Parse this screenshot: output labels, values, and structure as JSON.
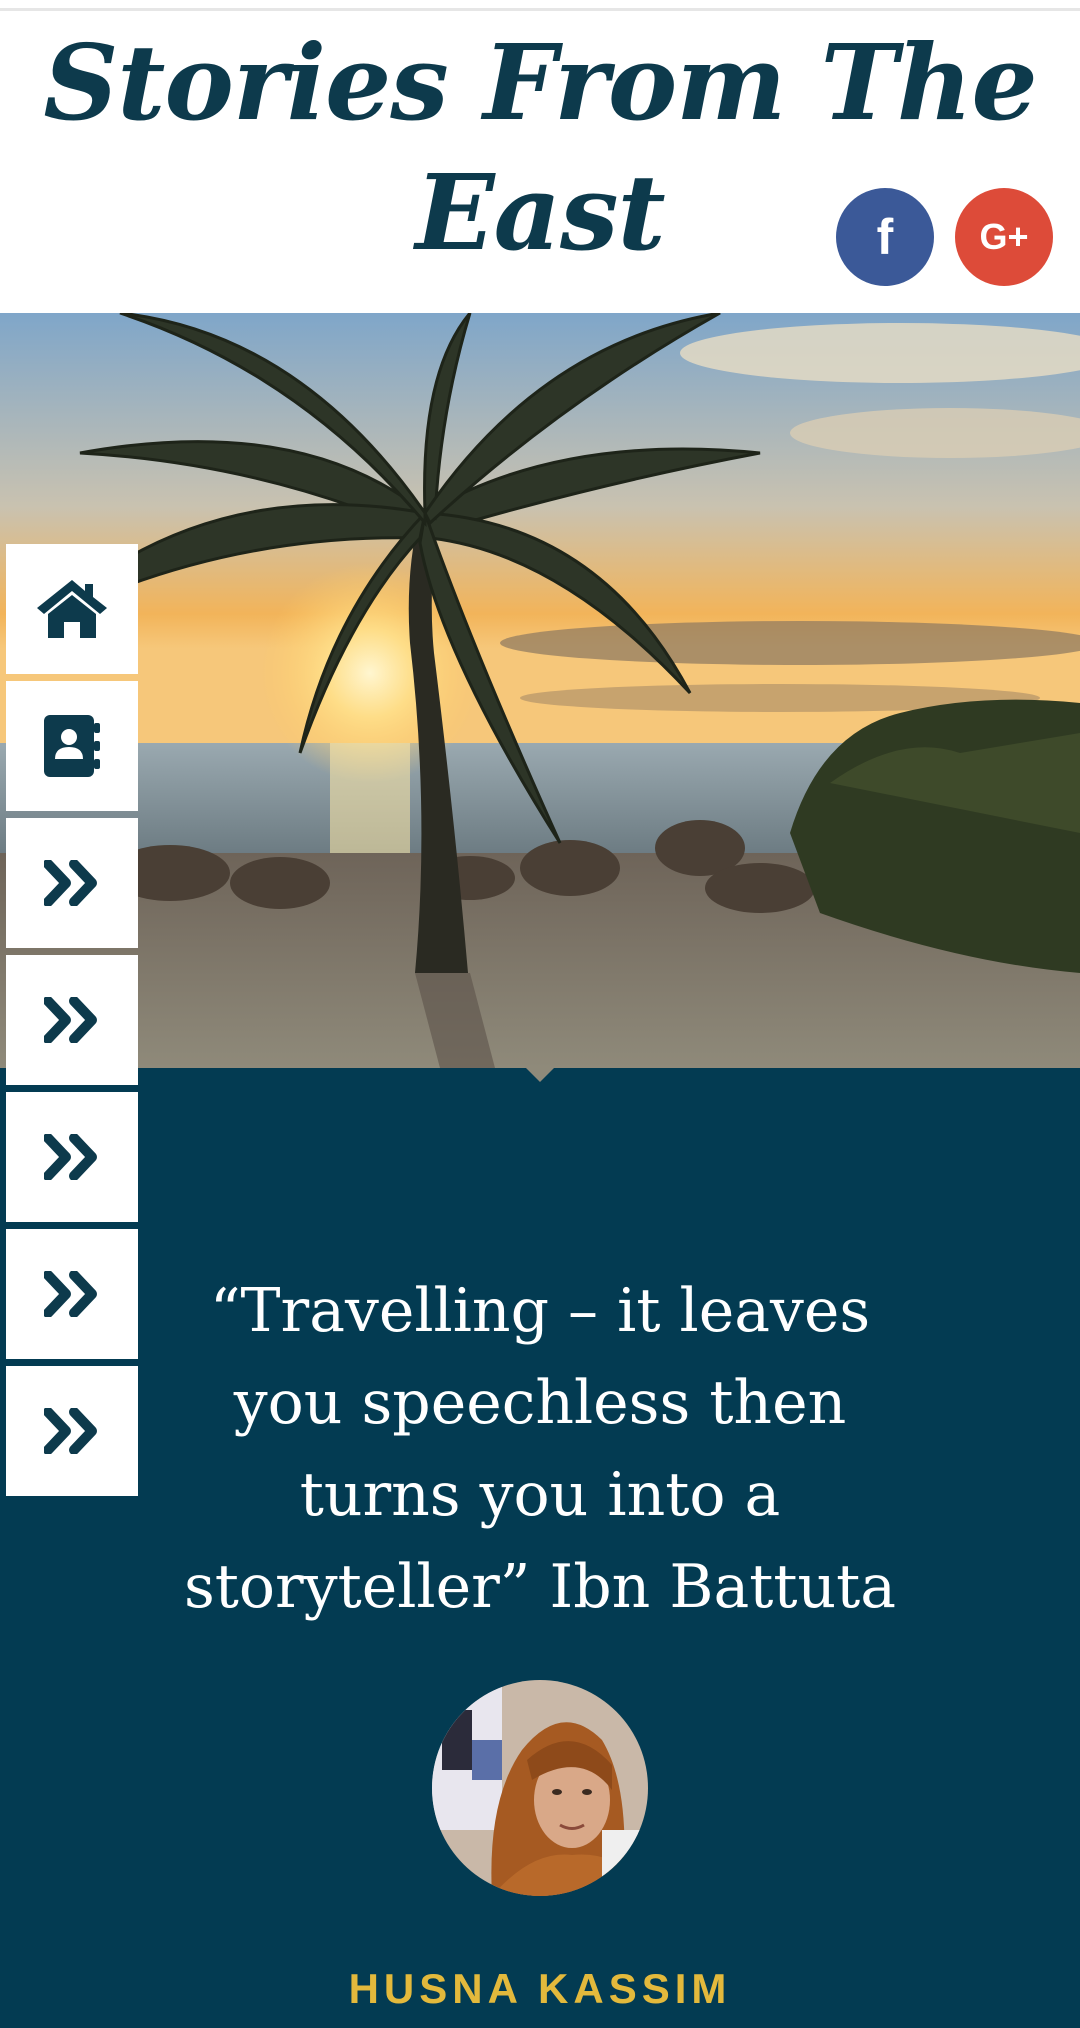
{
  "header": {
    "site_title": "Stories From The East",
    "social": [
      {
        "name": "facebook",
        "glyph": "f",
        "color": "#3b5998"
      },
      {
        "name": "google-plus",
        "glyph": "G+",
        "color": "#dd4b39"
      }
    ]
  },
  "side_nav": {
    "items": [
      {
        "icon": "home-icon"
      },
      {
        "icon": "contact-book-icon"
      },
      {
        "icon": "double-chevron-right-icon"
      },
      {
        "icon": "double-chevron-right-icon"
      },
      {
        "icon": "double-chevron-right-icon"
      },
      {
        "icon": "double-chevron-right-icon"
      },
      {
        "icon": "double-chevron-right-icon"
      }
    ]
  },
  "quote": {
    "text": "“Travelling – it leaves you speechless then turns you into a storyteller” Ibn Battuta",
    "author": "HUSNA KASSIM"
  },
  "colors": {
    "brand": "#0d3a4c",
    "section_bg": "#033b52",
    "author": "#e3b93c"
  }
}
